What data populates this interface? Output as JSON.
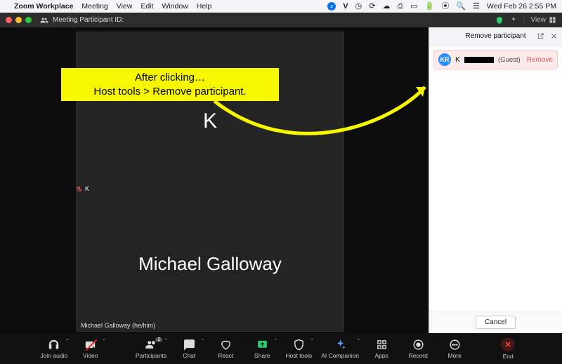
{
  "menubar": {
    "apple": "",
    "app_name": "Zoom Workplace",
    "items": [
      "Meeting",
      "View",
      "Edit",
      "Window",
      "Help"
    ],
    "clock": "Wed Feb 26  2:55 PM",
    "status_icons": [
      "zoom-status",
      "letter-v",
      "stopwatch",
      "updates",
      "cloud",
      "printer",
      "display",
      "battery",
      "wifi",
      "search",
      "control-center"
    ]
  },
  "zoom_title": {
    "label": "Meeting Participant ID:",
    "view_label": "View"
  },
  "video": {
    "top_initial": "K",
    "main_name": "Michael Galloway",
    "caption": "Michael Galloway (he/him)",
    "thumb_label": "K"
  },
  "panel": {
    "title": "Remove participant",
    "avatar_initials": "KR",
    "name_prefix": "K",
    "guest_suffix": "(Guest)",
    "remove_label": "Remove",
    "cancel_label": "Cancel"
  },
  "annotation": {
    "line1": "After clicking…",
    "line2": "Host tools > Remove participant."
  },
  "toolbar": {
    "join_audio": "Join audio",
    "video": "Video",
    "participants": "Participants",
    "participants_count": "2",
    "chat": "Chat",
    "react": "React",
    "share": "Share",
    "host_tools": "Host tools",
    "ai": "AI Companion",
    "apps": "Apps",
    "record": "Record",
    "more": "More",
    "end": "End"
  }
}
